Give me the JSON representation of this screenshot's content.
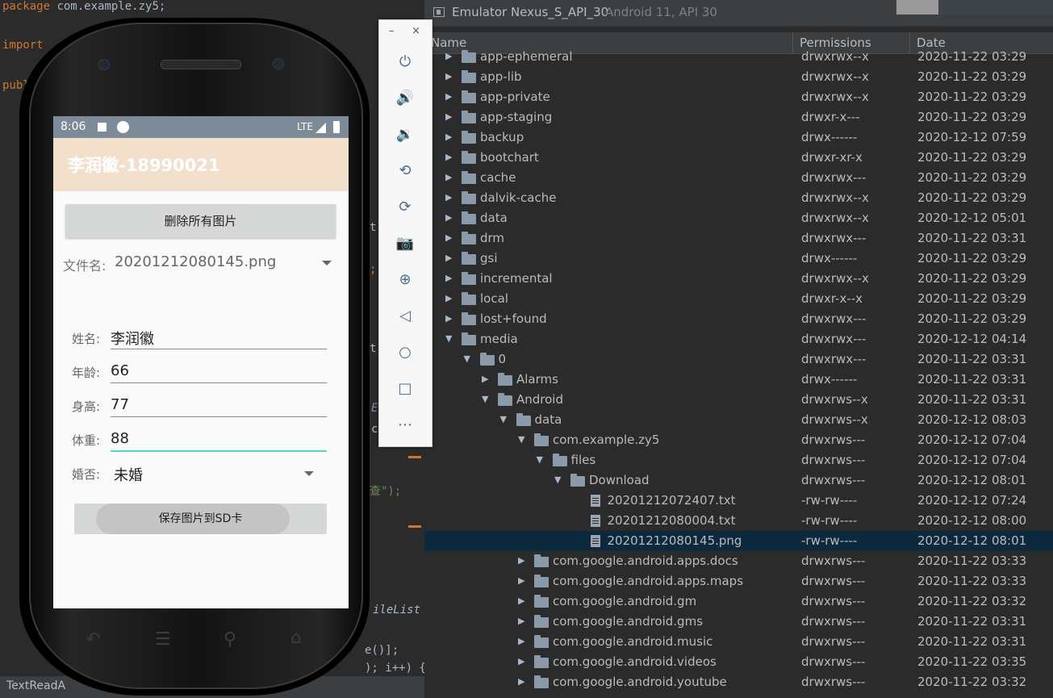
{
  "editor": {
    "lines": [
      {
        "kw": "package",
        "text": " com.example.zy5;"
      },
      {
        "kw": "import",
        "text": ""
      },
      {
        "kw": "publ",
        "text": ""
      }
    ],
    "fragments": [
      "t",
      ";",
      "t",
      "E",
      "c",
      "查\");",
      "ileList",
      "e()];",
      "); i++) {"
    ],
    "status_text": "TextReadA"
  },
  "explorer": {
    "title": "Emulator Nexus_S_API_30",
    "subtitle": "Android 11, API 30",
    "columns": {
      "name": "Name",
      "permissions": "Permissions",
      "date": "Date"
    },
    "rows": [
      {
        "depth": 0,
        "expanded": false,
        "type": "folder",
        "name": "app-ephemeral",
        "perm": "drwxrwx--x",
        "date": "2020-11-22 03:29"
      },
      {
        "depth": 0,
        "expanded": false,
        "type": "folder",
        "name": "app-lib",
        "perm": "drwxrwx--x",
        "date": "2020-11-22 03:29"
      },
      {
        "depth": 0,
        "expanded": false,
        "type": "folder",
        "name": "app-private",
        "perm": "drwxrwx--x",
        "date": "2020-11-22 03:29"
      },
      {
        "depth": 0,
        "expanded": false,
        "type": "folder",
        "name": "app-staging",
        "perm": "drwxr-x---",
        "date": "2020-11-22 03:29"
      },
      {
        "depth": 0,
        "expanded": false,
        "type": "folder",
        "name": "backup",
        "perm": "drwx------",
        "date": "2020-12-12 07:59"
      },
      {
        "depth": 0,
        "expanded": false,
        "type": "folder",
        "name": "bootchart",
        "perm": "drwxr-xr-x",
        "date": "2020-11-22 03:29"
      },
      {
        "depth": 0,
        "expanded": false,
        "type": "folder",
        "name": "cache",
        "perm": "drwxrwx---",
        "date": "2020-11-22 03:29"
      },
      {
        "depth": 0,
        "expanded": false,
        "type": "folder",
        "name": "dalvik-cache",
        "perm": "drwxrwx--x",
        "date": "2020-11-22 03:29"
      },
      {
        "depth": 0,
        "expanded": false,
        "type": "folder",
        "name": "data",
        "perm": "drwxrwx--x",
        "date": "2020-12-12 05:01"
      },
      {
        "depth": 0,
        "expanded": false,
        "type": "folder",
        "name": "drm",
        "perm": "drwxrwx---",
        "date": "2020-11-22 03:31"
      },
      {
        "depth": 0,
        "expanded": false,
        "type": "folder",
        "name": "gsi",
        "perm": "drwx------",
        "date": "2020-11-22 03:29"
      },
      {
        "depth": 0,
        "expanded": false,
        "type": "folder",
        "name": "incremental",
        "perm": "drwxrwx--x",
        "date": "2020-11-22 03:29"
      },
      {
        "depth": 0,
        "expanded": false,
        "type": "folder",
        "name": "local",
        "perm": "drwxr-x--x",
        "date": "2020-11-22 03:29"
      },
      {
        "depth": 0,
        "expanded": false,
        "type": "folder",
        "name": "lost+found",
        "perm": "drwxrwx---",
        "date": "2020-11-22 03:29"
      },
      {
        "depth": 0,
        "expanded": true,
        "type": "folder",
        "name": "media",
        "perm": "drwxrwx---",
        "date": "2020-12-12 04:14"
      },
      {
        "depth": 1,
        "expanded": true,
        "type": "folder",
        "name": "0",
        "perm": "drwxrwx---",
        "date": "2020-11-22 03:31"
      },
      {
        "depth": 2,
        "expanded": false,
        "type": "folder",
        "name": "Alarms",
        "perm": "drwx------",
        "date": "2020-11-22 03:31"
      },
      {
        "depth": 2,
        "expanded": true,
        "type": "folder",
        "name": "Android",
        "perm": "drwxrws--x",
        "date": "2020-11-22 03:31"
      },
      {
        "depth": 3,
        "expanded": true,
        "type": "folder",
        "name": "data",
        "perm": "drwxrws--x",
        "date": "2020-12-12 08:03"
      },
      {
        "depth": 4,
        "expanded": true,
        "type": "folder",
        "name": "com.example.zy5",
        "perm": "drwxrws---",
        "date": "2020-12-12 07:04"
      },
      {
        "depth": 5,
        "expanded": true,
        "type": "folder",
        "name": "files",
        "perm": "drwxrws---",
        "date": "2020-12-12 07:04"
      },
      {
        "depth": 6,
        "expanded": true,
        "type": "folder",
        "name": "Download",
        "perm": "drwxrws---",
        "date": "2020-12-12 08:01"
      },
      {
        "depth": 7,
        "expanded": false,
        "type": "file",
        "name": "20201212072407.txt",
        "perm": "-rw-rw----",
        "date": "2020-12-12 07:24"
      },
      {
        "depth": 7,
        "expanded": false,
        "type": "file",
        "name": "20201212080004.txt",
        "perm": "-rw-rw----",
        "date": "2020-12-12 08:00"
      },
      {
        "depth": 7,
        "expanded": false,
        "type": "file",
        "name": "20201212080145.png",
        "perm": "-rw-rw----",
        "date": "2020-12-12 08:01",
        "selected": true
      },
      {
        "depth": 4,
        "expanded": false,
        "type": "folder",
        "name": "com.google.android.apps.docs",
        "perm": "drwxrws---",
        "date": "2020-11-22 03:33"
      },
      {
        "depth": 4,
        "expanded": false,
        "type": "folder",
        "name": "com.google.android.apps.maps",
        "perm": "drwxrws---",
        "date": "2020-11-22 03:33"
      },
      {
        "depth": 4,
        "expanded": false,
        "type": "folder",
        "name": "com.google.android.gm",
        "perm": "drwxrws---",
        "date": "2020-11-22 03:32"
      },
      {
        "depth": 4,
        "expanded": false,
        "type": "folder",
        "name": "com.google.android.gms",
        "perm": "drwxrws---",
        "date": "2020-11-22 03:31"
      },
      {
        "depth": 4,
        "expanded": false,
        "type": "folder",
        "name": "com.google.android.music",
        "perm": "drwxrws---",
        "date": "2020-11-22 03:31"
      },
      {
        "depth": 4,
        "expanded": false,
        "type": "folder",
        "name": "com.google.android.videos",
        "perm": "drwxrws---",
        "date": "2020-11-22 03:35"
      },
      {
        "depth": 4,
        "expanded": false,
        "type": "folder",
        "name": "com.google.android.youtube",
        "perm": "drwxrws---",
        "date": "2020-11-22 03:32"
      }
    ]
  },
  "toolbar": {
    "minimize": "–",
    "close": "×",
    "buttons": [
      {
        "name": "power-icon",
        "glyph": "⏻"
      },
      {
        "name": "volume-up-icon",
        "glyph": "🔊"
      },
      {
        "name": "volume-down-icon",
        "glyph": "🔉"
      },
      {
        "name": "rotate-left-icon",
        "glyph": "⟲"
      },
      {
        "name": "rotate-right-icon",
        "glyph": "⟳"
      },
      {
        "name": "camera-icon",
        "glyph": "📷"
      },
      {
        "name": "zoom-icon",
        "glyph": "⊕"
      },
      {
        "name": "back-icon",
        "glyph": "◁"
      },
      {
        "name": "home-icon",
        "glyph": "○"
      },
      {
        "name": "overview-icon",
        "glyph": "□"
      },
      {
        "name": "more-icon",
        "glyph": "⋯"
      }
    ]
  },
  "phone": {
    "status": {
      "time": "8:06",
      "network": "LTE"
    },
    "app_title": "李润徽-18990021",
    "delete_button": "删除所有图片",
    "file_label": "文件名:",
    "file_value": "20201212080145.png",
    "fields": [
      {
        "label": "姓名:",
        "value": "李润徽"
      },
      {
        "label": "年龄:",
        "value": "66"
      },
      {
        "label": "身高:",
        "value": "77"
      },
      {
        "label": "体重:",
        "value": "88"
      }
    ],
    "married_label": "婚否:",
    "married_value": "未婚",
    "save_button": "保存图片到SD卡",
    "nav_keys": {
      "back": "↶",
      "menu": "☰",
      "search": "⚲",
      "home": "⌂"
    }
  }
}
